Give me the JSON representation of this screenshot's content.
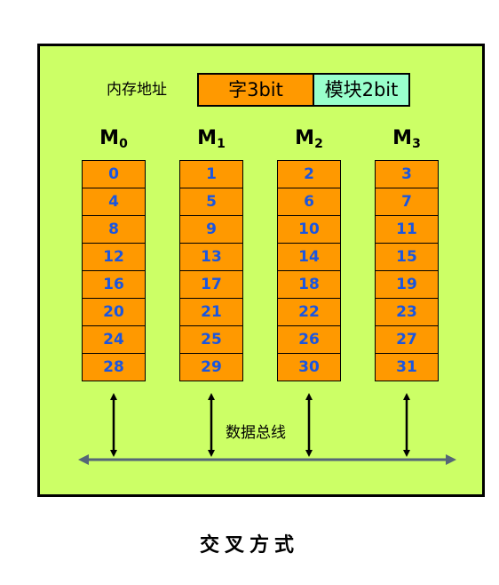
{
  "address": {
    "label": "内存地址",
    "word_field": "字3bit",
    "module_field": "模块2bit"
  },
  "modules": [
    {
      "name": "M",
      "sub": "0",
      "cells": [
        "0",
        "4",
        "8",
        "12",
        "16",
        "20",
        "24",
        "28"
      ]
    },
    {
      "name": "M",
      "sub": "1",
      "cells": [
        "1",
        "5",
        "9",
        "13",
        "17",
        "21",
        "25",
        "29"
      ]
    },
    {
      "name": "M",
      "sub": "2",
      "cells": [
        "2",
        "6",
        "10",
        "14",
        "18",
        "22",
        "26",
        "30"
      ]
    },
    {
      "name": "M",
      "sub": "3",
      "cells": [
        "3",
        "7",
        "11",
        "15",
        "19",
        "23",
        "27",
        "31"
      ]
    }
  ],
  "bus": {
    "label": "数据总线"
  },
  "caption": "交叉方式",
  "colors": {
    "panel": "#ccff66",
    "cell": "#ff9900",
    "cell_text": "#1a56e0",
    "module_field": "#99ffcc",
    "bus": "#556677"
  }
}
